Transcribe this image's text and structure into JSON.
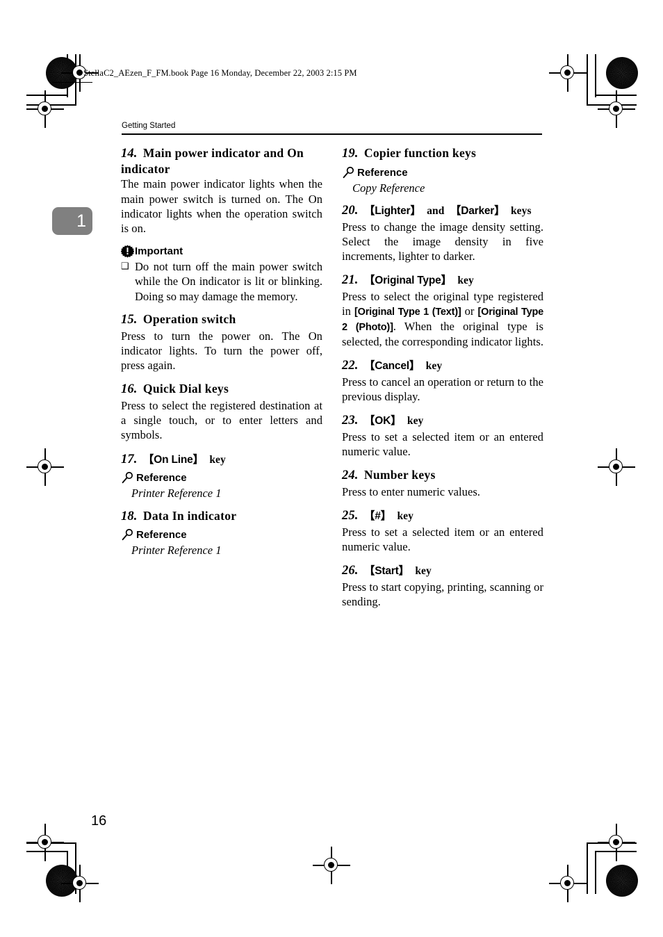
{
  "page": {
    "book_header": "StellaC2_AEzen_F_FM.book  Page 16  Monday, December 22, 2003  2:15 PM",
    "running_head": "Getting Started",
    "chapter_tab": "1",
    "page_number": "16"
  },
  "icons": {
    "important": "important-starburst-icon",
    "reference": "magnifier-icon",
    "bullet": "square-bullet"
  },
  "labels": {
    "important": "Important",
    "reference": "Reference"
  },
  "left_column": [
    {
      "type": "item",
      "number": "14.",
      "title": "Main power indicator and On indicator",
      "body": "The main power indicator lights when the main power switch is turned on. The On indicator lights when the operation switch is on."
    },
    {
      "type": "important",
      "bullet": "Do not turn off the main power switch while the On indicator is lit or blinking. Doing so may damage the memory."
    },
    {
      "type": "item",
      "number": "15.",
      "title": "Operation switch",
      "body": "Press to turn the power on. The On indicator lights. To turn the power off, press again."
    },
    {
      "type": "item",
      "number": "16.",
      "title": "Quick Dial keys",
      "body": "Press to select the registered destination at a single touch, or to enter letters and symbols."
    },
    {
      "type": "item-key",
      "number": "17.",
      "key": "【On Line】",
      "suffix": "key"
    },
    {
      "type": "reference",
      "text": "Printer Reference 1"
    },
    {
      "type": "item-title-only",
      "number": "18.",
      "title": "Data In indicator"
    },
    {
      "type": "reference",
      "text": "Printer Reference 1"
    }
  ],
  "right_column": [
    {
      "type": "item-title-only",
      "number": "19.",
      "title": "Copier function keys"
    },
    {
      "type": "reference",
      "text": "Copy Reference"
    },
    {
      "type": "item-key2",
      "number": "20.",
      "key1": "【Lighter】",
      "mid": "and",
      "key2": "【Darker】",
      "suffix": "keys",
      "body": "Press to change the image density setting. Select the image density in five increments, lighter to darker."
    },
    {
      "type": "item-key",
      "number": "21.",
      "key": "【Original Type】",
      "suffix": "key",
      "body_parts": [
        {
          "style": "normal",
          "text": "Press to select the original type registered in "
        },
        {
          "style": "ui",
          "text": "[Original Type 1 (Text)]"
        },
        {
          "style": "normal",
          "text": " or "
        },
        {
          "style": "ui",
          "text": "[Original Type 2 (Photo)]"
        },
        {
          "style": "normal",
          "text": ". When the original type is selected, the corresponding indicator lights."
        }
      ]
    },
    {
      "type": "item-key",
      "number": "22.",
      "key": "【Cancel】",
      "suffix": "key",
      "body": "Press to cancel an operation or return to the previous display."
    },
    {
      "type": "item-key",
      "number": "23.",
      "key": "【OK】",
      "suffix": "key",
      "body": "Press to set a selected item or an entered numeric value."
    },
    {
      "type": "item-title-only",
      "number": "24.",
      "title": "Number keys",
      "body": "Press to enter numeric values."
    },
    {
      "type": "item-key",
      "number": "25.",
      "key": "【#】",
      "suffix": "key",
      "body": "Press to set a selected item or an entered numeric value."
    },
    {
      "type": "item-key",
      "number": "26.",
      "key": "【Start】",
      "suffix": "key",
      "body": "Press to start copying, printing, scanning or sending."
    }
  ]
}
